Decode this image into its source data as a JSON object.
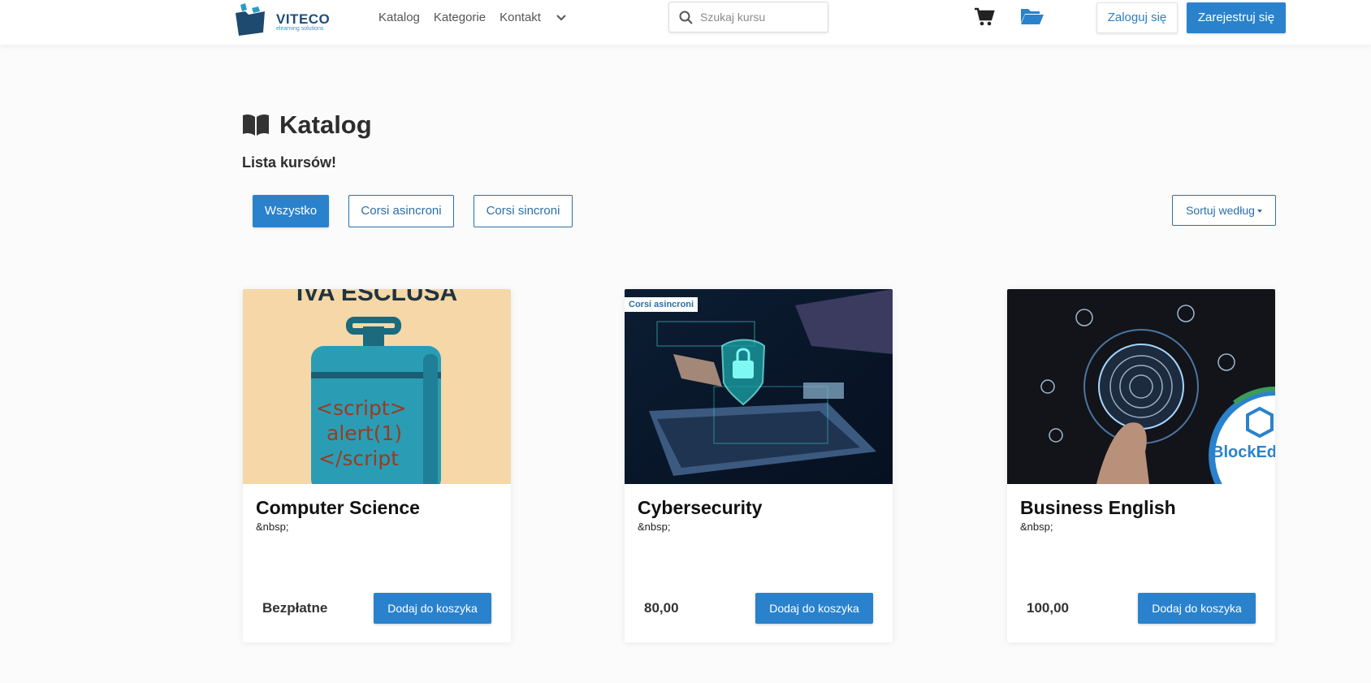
{
  "header": {
    "brand": "VITECO",
    "tagline": "elearning solutions",
    "nav": [
      "Katalog",
      "Kategorie",
      "Kontakt"
    ],
    "search_placeholder": "Szukaj kursu",
    "login_label": "Zaloguj się",
    "register_label": "Zarejestruj się"
  },
  "page": {
    "title": "Katalog",
    "subtitle": "Lista kursów!"
  },
  "filters": {
    "all": "Wszystko",
    "async": "Corsi asincroni",
    "sync": "Corsi sincroni",
    "sort": "Sortuj według"
  },
  "courses": [
    {
      "title": "Computer Science",
      "description": "&nbsp;",
      "price": "Bezpłatne",
      "add_label": "Dodaj do koszyka",
      "image_text": [
        "IVA ESCLUSA",
        "<script>",
        "alert(1)",
        "</script"
      ]
    },
    {
      "title": "Cybersecurity",
      "description": "&nbsp;",
      "price": "80,00",
      "add_label": "Dodaj do koszyka",
      "badge": "Corsi asincroni"
    },
    {
      "title": "Business English",
      "description": "&nbsp;",
      "price": "100,00",
      "add_label": "Dodaj do koszyka",
      "image_text": [
        "BlockEd"
      ]
    }
  ],
  "colors": {
    "primary": "#2a82cc",
    "outline": "#2b6fa8",
    "brand_dark": "#1f4d7a"
  }
}
